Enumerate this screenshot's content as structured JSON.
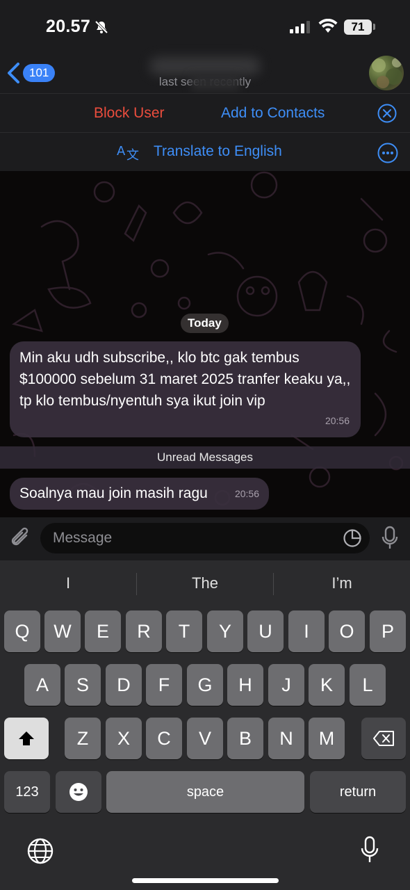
{
  "status_bar": {
    "time": "20.57",
    "battery": "71"
  },
  "header": {
    "back_count": "101",
    "contact_status": "last seen recently"
  },
  "actions": {
    "block_label": "Block User",
    "add_contact_label": "Add to Contacts",
    "translate_label": "Translate to English"
  },
  "chat": {
    "date_label": "Today",
    "messages": [
      {
        "text": "Min aku udh subscribe,, klo btc gak tembus $100000 sebelum 31 maret 2025 tranfer keaku ya,, tp klo tembus/nyentuh sya ikut join vip",
        "time": "20:56"
      },
      {
        "text": "Soalnya mau join masih ragu",
        "time": "20:56"
      }
    ],
    "unread_label": "Unread Messages"
  },
  "input": {
    "placeholder": "Message"
  },
  "keyboard": {
    "suggestions": [
      "I",
      "The",
      "I’m"
    ],
    "row1": [
      "Q",
      "W",
      "E",
      "R",
      "T",
      "Y",
      "U",
      "I",
      "O",
      "P"
    ],
    "row2": [
      "A",
      "S",
      "D",
      "F",
      "G",
      "H",
      "J",
      "K",
      "L"
    ],
    "row3": [
      "Z",
      "X",
      "C",
      "V",
      "B",
      "N",
      "M"
    ],
    "numbers_label": "123",
    "space_label": "space",
    "return_label": "return"
  },
  "colors": {
    "accent": "#3e8ef7",
    "danger": "#eb4d3d",
    "bubble": "#3a303e"
  },
  "icons": [
    "bell-slash-icon",
    "signal-icon",
    "wifi-icon",
    "chevron-left-icon",
    "close-icon",
    "translate-icon",
    "more-icon",
    "attach-icon",
    "sticker-icon",
    "mic-icon",
    "shift-icon",
    "backspace-icon",
    "emoji-icon",
    "globe-icon"
  ]
}
